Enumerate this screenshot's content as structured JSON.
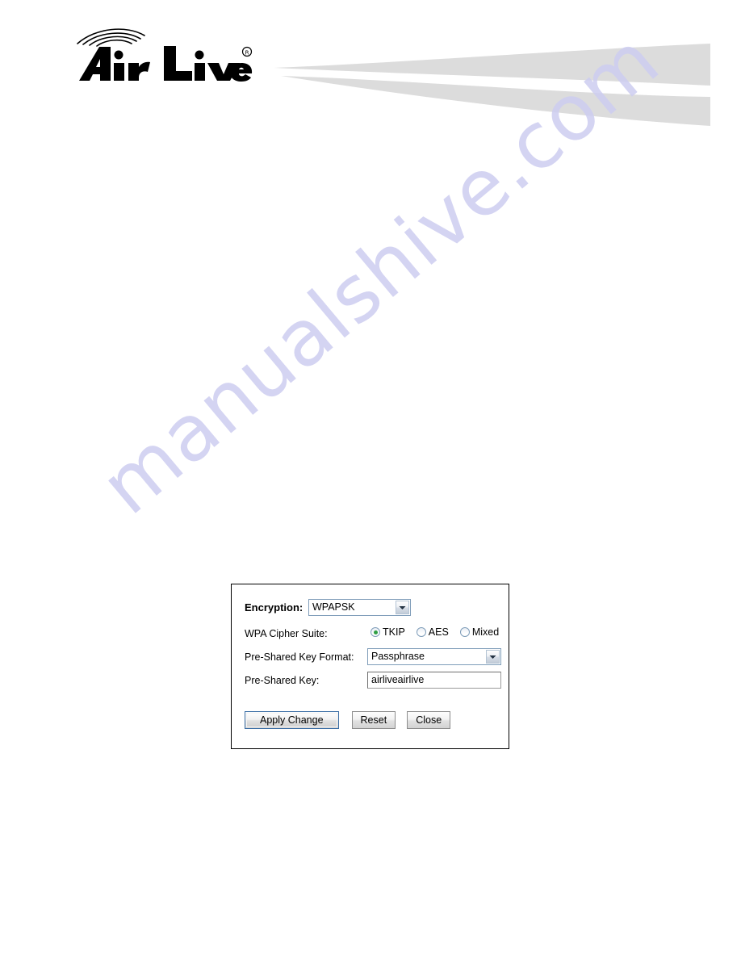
{
  "header": {
    "brand_name": "AirLive",
    "brand_registered_mark": "®",
    "logo_icon": "airlive-wireless-logo",
    "swoosh_icon": "header-swoosh-graphic",
    "swoosh_color": "#dcdcdc"
  },
  "watermark": {
    "text": "manualshive.com",
    "color": "#cdcdf0"
  },
  "dialog": {
    "encryption": {
      "label": "Encryption:",
      "value": "WPAPSK",
      "arrow_icon": "chevron-down-icon"
    },
    "cipher_suite": {
      "label": "WPA Cipher Suite:",
      "options": [
        {
          "label": "TKIP",
          "selected": true
        },
        {
          "label": "AES",
          "selected": false
        },
        {
          "label": "Mixed",
          "selected": false
        }
      ],
      "selected_color": "#2f9e44"
    },
    "key_format": {
      "label": "Pre-Shared Key Format:",
      "value": "Passphrase",
      "arrow_icon": "chevron-down-icon"
    },
    "pre_shared_key": {
      "label": "Pre-Shared Key:",
      "value": "airliveairlive"
    },
    "buttons": {
      "apply": "Apply Change",
      "reset": "Reset",
      "close": "Close"
    }
  }
}
